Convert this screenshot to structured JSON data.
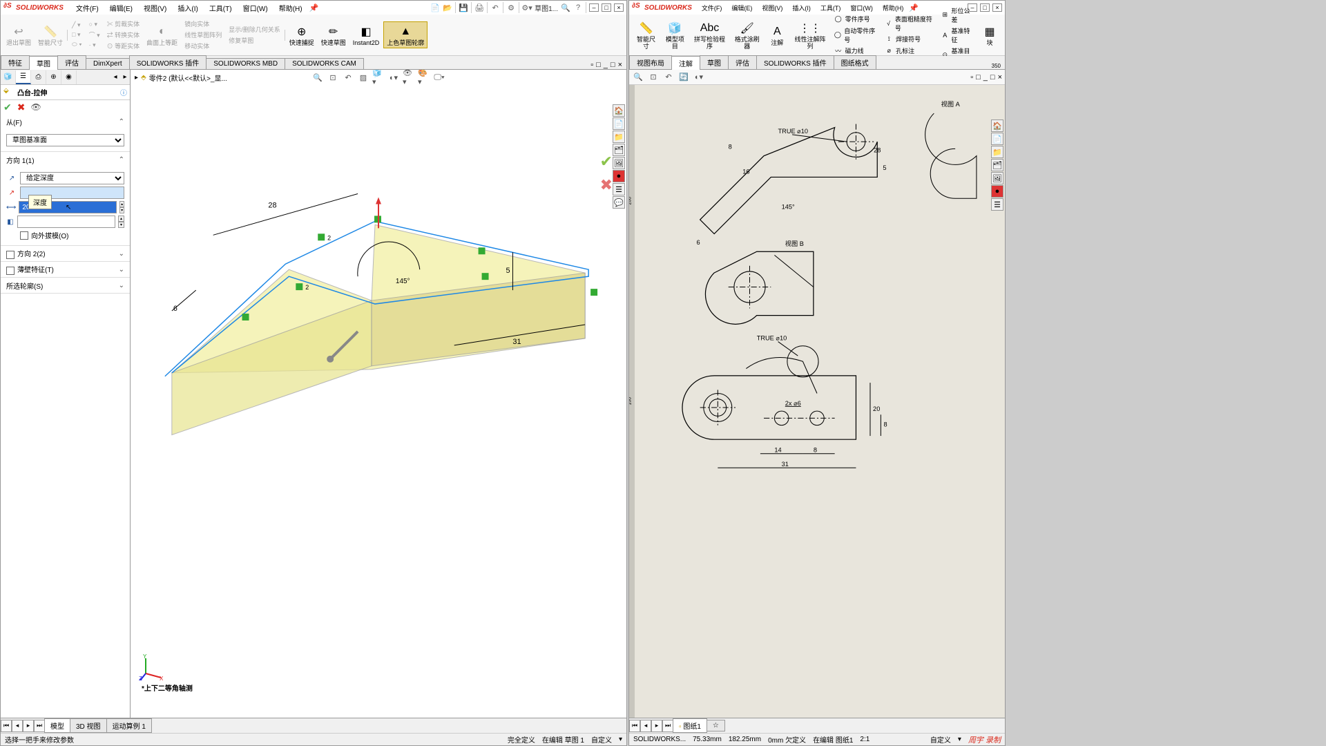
{
  "app_name": "SOLIDWORKS",
  "left_window": {
    "menu": [
      "文件(F)",
      "编辑(E)",
      "视图(V)",
      "插入(I)",
      "工具(T)",
      "窗口(W)",
      "帮助(H)"
    ],
    "qa_doc": "草图1...",
    "ribbon": {
      "items": [
        "退出草图",
        "智能尺寸"
      ],
      "active_btns": [
        "快速捕捉",
        "快速草图",
        "Instant2D",
        "上色草图轮廓"
      ],
      "disabled_row1": [
        "镜向实体",
        "线性草图阵列",
        "移动实体"
      ]
    },
    "tabs": [
      "特征",
      "草图",
      "评估",
      "DimXpert",
      "SOLIDWORKS 插件",
      "SOLIDWORKS MBD",
      "SOLIDWORKS CAM"
    ],
    "active_tab": "草图",
    "breadcrumb_part": "零件2 (默认<<默认>_显...",
    "prop": {
      "title": "凸台-拉伸",
      "section_from": "从(F)",
      "from_plane": "草图基准面",
      "section_dir1": "方向 1(1)",
      "dir1_type": "给定深度",
      "depth_value": "20.00mm",
      "tooltip_depth": "深度",
      "draft_label": "向外拔模(O)",
      "section_dir2": "方向 2(2)",
      "section_thin": "薄壁特征(T)",
      "section_contour": "所选轮廓(S)"
    },
    "dimensions": {
      "d28": "28",
      "d6": "6",
      "d2a": "2",
      "d2b": "2",
      "d145": "145°",
      "d5": "5",
      "d31": "31"
    },
    "view_label": "*上下二等角轴测",
    "bottom_tabs": [
      "模型",
      "3D 视图",
      "运动算例 1"
    ],
    "status_left": "选择一把手来修改参数",
    "status_center": [
      "完全定义",
      "在编辑 草图 1",
      "自定义"
    ]
  },
  "right_window": {
    "menu": [
      "文件(F)",
      "编辑(E)",
      "视图(V)",
      "插入(I)",
      "工具(T)",
      "窗口(W)",
      "帮助(H)"
    ],
    "ribbon_cols": {
      "col1": [
        "智能尺寸",
        "模型项目",
        "拼写检验程序",
        "格式涂刷器",
        "注解",
        "线性注解阵列"
      ],
      "row_items": [
        [
          "零件序号",
          "表面粗糙度符号",
          "形位公差"
        ],
        [
          "自动零件序号",
          "焊接符号",
          "基准特征"
        ],
        [
          "磁力线",
          "孔标注",
          "基准目标"
        ]
      ],
      "extra": "块"
    },
    "tabs": [
      "视图布局",
      "注解",
      "草图",
      "评估",
      "SOLIDWORKS 插件",
      "图纸格式"
    ],
    "active_tab": "注解",
    "ruler_vals_h": [
      "°",
      "350"
    ],
    "ruler_vals_v": [
      "200",
      "100"
    ],
    "drawing_labels": {
      "true10_1": "TRUE ⌀10",
      "true10_2": "TRUE ⌀10",
      "view_a": "视图 A",
      "view_b": "视图 B",
      "d8": "8",
      "d16": "16",
      "d145": "145°",
      "d6": "6",
      "d5_a": "5",
      "d28": "28",
      "d5_b": "5",
      "d2x6": "2x ⌀6",
      "d14": "14",
      "d8b": "8",
      "d31": "31",
      "d20": "20",
      "d8c": "8"
    },
    "sheet_tab": "图纸1",
    "status": [
      "SOLIDWORKS...",
      "75.33mm",
      "182.25mm",
      "0mm 欠定义",
      "在编辑 图纸1",
      "2:1",
      "自定义"
    ],
    "watermark": "周宇 录制"
  }
}
